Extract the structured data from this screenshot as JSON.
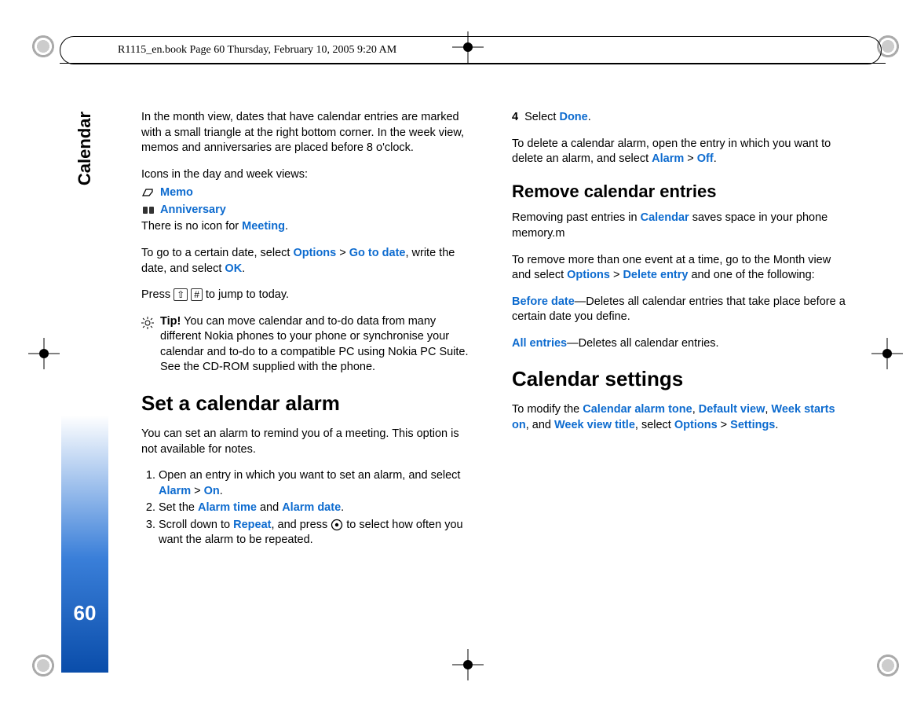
{
  "header": {
    "framemaker_line": "R1115_en.book  Page 60  Thursday, February 10, 2005  9:20 AM"
  },
  "sidebar": {
    "section": "Calendar",
    "page_number": "60"
  },
  "left": {
    "p1": "In the month view, dates that have calendar entries are marked with a small triangle at the right bottom corner. In the week view, memos and anniversaries are placed before 8 o'clock.",
    "icons_intro": "Icons in the day and week views:",
    "memo_label": "Memo",
    "anniversary_label": "Anniversary",
    "no_icon_prefix": "There is no icon for ",
    "meeting": "Meeting",
    "goto_1": "To go to a certain date, select ",
    "options": "Options",
    "gt": " > ",
    "go_to_date": "Go to date",
    "goto_2": ", write the date, and select ",
    "ok": "OK",
    "press_prefix": "Press ",
    "press_suffix": " to jump to today.",
    "tip_label": "Tip!",
    "tip_body": " You can move calendar and to-do data from many different Nokia phones to your phone or synchronise your calendar and to-do to a compatible PC using Nokia PC Suite. See the CD-ROM supplied with the phone.",
    "h_set_alarm": "Set a calendar alarm",
    "alarm_intro": "You can set an alarm to remind you of a meeting. This option is not available for notes.",
    "step1_a": "Open an entry in which you want to set an alarm, and select ",
    "alarm": "Alarm",
    "on": "On",
    "step2_a": "Set the ",
    "alarm_time": "Alarm time",
    "and": " and ",
    "alarm_date": "Alarm date",
    "step3_a": "Scroll down to ",
    "repeat": "Repeat",
    "step3_b": ", and press ",
    "step3_c": " to select how often you want the alarm to be repeated."
  },
  "right": {
    "step4_a": "Select ",
    "done": "Done",
    "delete_intro_a": "To delete a calendar alarm, open the entry in which you want to delete an alarm, and select ",
    "alarm": "Alarm",
    "gt": " > ",
    "off": "Off",
    "h_remove": "Remove calendar entries",
    "remove_p1_a": "Removing past entries in ",
    "calendar": "Calendar",
    "remove_p1_b": " saves space in your phone memory.m",
    "remove_p2_a": "To remove more than one event at a time, go to the Month view and select ",
    "options": "Options",
    "delete_entry": "Delete entry",
    "remove_p2_b": " and one of the following:",
    "before_date": "Before date",
    "before_date_body": "—Deletes all calendar entries that take place before a certain date you define.",
    "all_entries": "All entries",
    "all_entries_body": "—Deletes all calendar entries.",
    "h_settings": "Calendar settings",
    "settings_a": "To modify the ",
    "calendar_alarm_tone": "Calendar alarm tone",
    "comma": ", ",
    "default_view": "Default view",
    "week_starts_on": "Week starts on",
    "and": ", and ",
    "week_view_title": "Week view title",
    "settings_b": ", select ",
    "settings_c": "Settings",
    "period": "."
  }
}
